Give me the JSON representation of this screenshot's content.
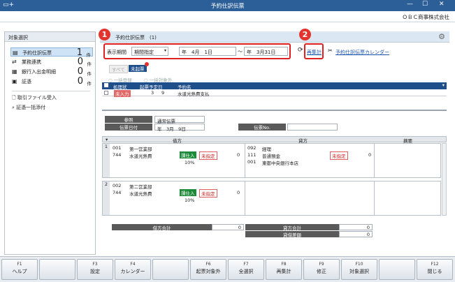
{
  "window": {
    "title": "予約仕訳伝票",
    "company": "ＯＢＣ商事株式会社"
  },
  "left": {
    "header": "対象選択",
    "items": [
      {
        "label": "予約仕訳伝票",
        "count": "1",
        "unit": "件"
      },
      {
        "label": "業務連携",
        "count": "0",
        "unit": "件"
      },
      {
        "label": "銀行入出金明細",
        "count": "0",
        "unit": "件"
      },
      {
        "label": "証憑",
        "count": "0",
        "unit": "件"
      }
    ],
    "links": [
      "取引ファイル受入",
      "証憑一括添付"
    ]
  },
  "main": {
    "title": "予約仕訳伝票　(1)",
    "filter": {
      "label": "表示期間",
      "mode": "期間指定",
      "from": "年　4月　1日",
      "tilde": "～",
      "to": "年　3月31日"
    },
    "recalc": "再集計",
    "calendar_link": "予約仕訳伝票カレンダー",
    "badge1": "1",
    "badge2": "2",
    "tabs": {
      "all": "すべて",
      "unrecorded": "未起票"
    },
    "radios": [
      "一括登録",
      "一括対象外"
    ],
    "grid": {
      "headers": [
        "処理状",
        "起票予定日",
        "予約名"
      ],
      "row": {
        "status": "未入力",
        "month": "3",
        "day": "9",
        "name": "水道光熱費支払"
      }
    },
    "detail": {
      "ref_label": "参照",
      "ref_value": "通常伝票",
      "date_label": "伝票日付",
      "date_value": "年　3月　9日",
      "slip_no_label": "伝票No.",
      "debit_header": "借方",
      "credit_header": "貸方",
      "memo_header": "摘要",
      "lines": [
        {
          "no": "1",
          "d_code1": "001",
          "d_name1": "第一営業部",
          "d_code2": "744",
          "d_name2": "水道光熱費",
          "d_tax": "課仕入",
          "d_flag": "未指定",
          "d_amount": "0",
          "d_rate": "10%",
          "c_code1": "092",
          "c_name1": "経理",
          "c_code2": "111",
          "c_name2": "普通預金",
          "c_code3": "001",
          "c_name3": "東都中央銀行本店",
          "c_flag": "未指定",
          "c_amount": "0"
        },
        {
          "no": "2",
          "d_code1": "002",
          "d_name1": "第二営業部",
          "d_code2": "744",
          "d_name2": "水道光熱費",
          "d_tax": "課仕入",
          "d_flag": "未指定",
          "d_amount": "0",
          "d_rate": "10%"
        }
      ],
      "debit_total_label": "借方合計",
      "debit_total": "0",
      "credit_total_label": "貸方合計",
      "credit_total": "0",
      "diff_label": "貸借差額",
      "diff": "0"
    }
  },
  "fkeys": [
    {
      "key": "F1",
      "label": "ヘルプ"
    },
    {
      "key": "",
      "label": ""
    },
    {
      "key": "F3",
      "label": "設定"
    },
    {
      "key": "F4",
      "label": "カレンダー"
    },
    {
      "key": "",
      "label": ""
    },
    {
      "key": "F6",
      "label": "起票対象外"
    },
    {
      "key": "F7",
      "label": "全選択"
    },
    {
      "key": "F8",
      "label": "再集計"
    },
    {
      "key": "F9",
      "label": "修正"
    },
    {
      "key": "F10",
      "label": "対象選択"
    },
    {
      "key": "",
      "label": ""
    },
    {
      "key": "F12",
      "label": "閉じる"
    }
  ]
}
